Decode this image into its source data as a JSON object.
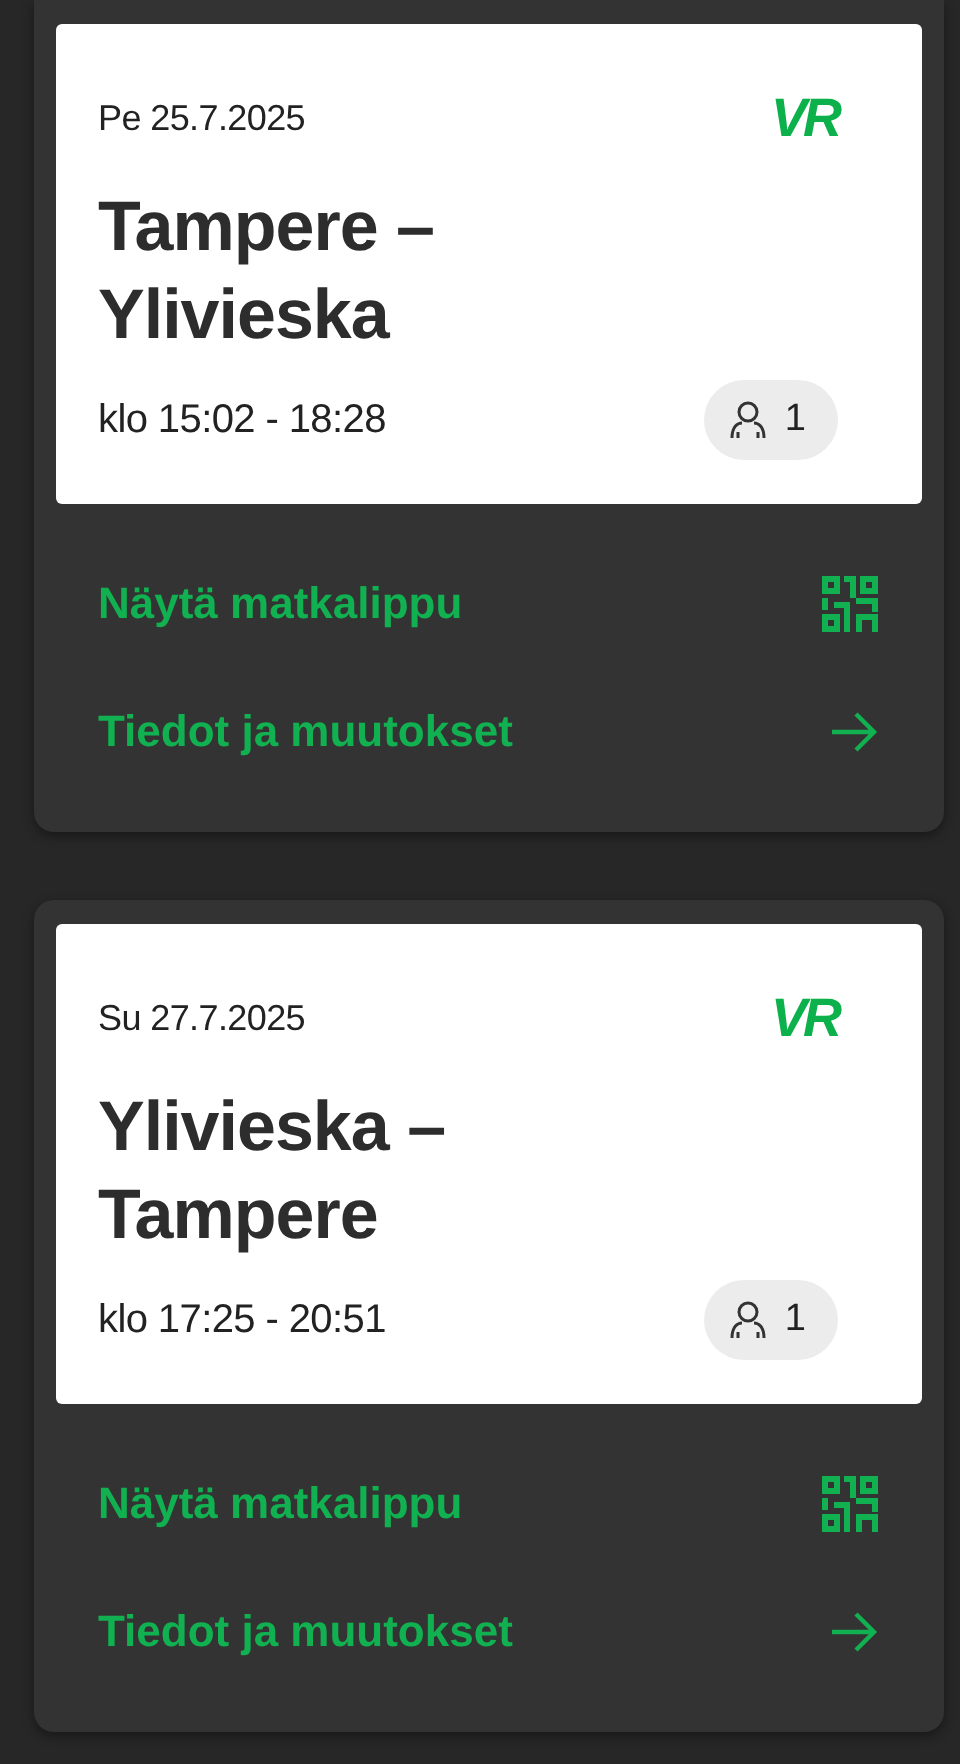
{
  "trips": [
    {
      "date": "Pe 25.7.2025",
      "logo": "VR",
      "route": "Tampere – Ylivieska",
      "time": "klo 15:02 - 18:28",
      "passengers": "1",
      "actions": [
        {
          "kind": "ticket",
          "label": "Näytä matkalippu"
        },
        {
          "kind": "details",
          "label": "Tiedot ja muutokset"
        }
      ]
    },
    {
      "date": "Su 27.7.2025",
      "logo": "VR",
      "route": "Ylivieska – Tampere",
      "time": "klo 17:25 - 20:51",
      "passengers": "1",
      "actions": [
        {
          "kind": "ticket",
          "label": "Näytä matkalippu"
        },
        {
          "kind": "details",
          "label": "Tiedot ja muutokset"
        }
      ]
    }
  ]
}
